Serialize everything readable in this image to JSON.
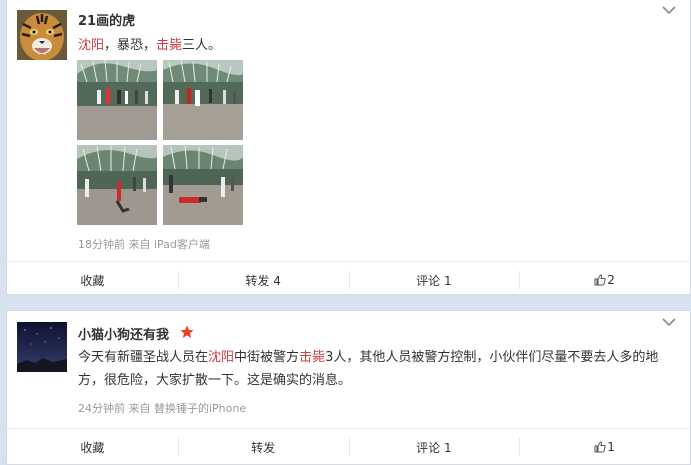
{
  "posts": [
    {
      "username": "21画的虎",
      "text_parts": {
        "p1": "沈阳",
        "p2": "，暴恐，",
        "p3": "击毙",
        "p4": "三人。"
      },
      "meta": "18分钟前 来自 iPad客户端",
      "actions": {
        "favorite": "收藏",
        "repost": "转发 4",
        "comment": "评论 1",
        "like_count": "2"
      },
      "images": [
        "photo-1",
        "photo-2",
        "photo-3",
        "photo-4"
      ]
    },
    {
      "username": "小猫小狗还有我",
      "verified_badge": "star-icon",
      "text_parts": {
        "p1": "今天有新疆圣战人员在",
        "p2": "沈阳",
        "p3": "中街被警方",
        "p4": "击毙",
        "p5": "3人，其他人员被警方控制，小伙伴们尽量不要去人多的地方，很危险，大家扩散一下。这是确实的消息。"
      },
      "meta": "24分钟前 来自 替换锤子的iPhone",
      "actions": {
        "favorite": "收藏",
        "repost": "转发",
        "comment": "评论 1",
        "like_count": "1"
      }
    }
  ],
  "colors": {
    "background": "#d8e1ee",
    "keyword": "#d0393e",
    "meta": "#999999",
    "star": "#e8402a"
  },
  "icons": [
    "chevron-down-icon",
    "thumbs-up-icon",
    "star-icon"
  ]
}
